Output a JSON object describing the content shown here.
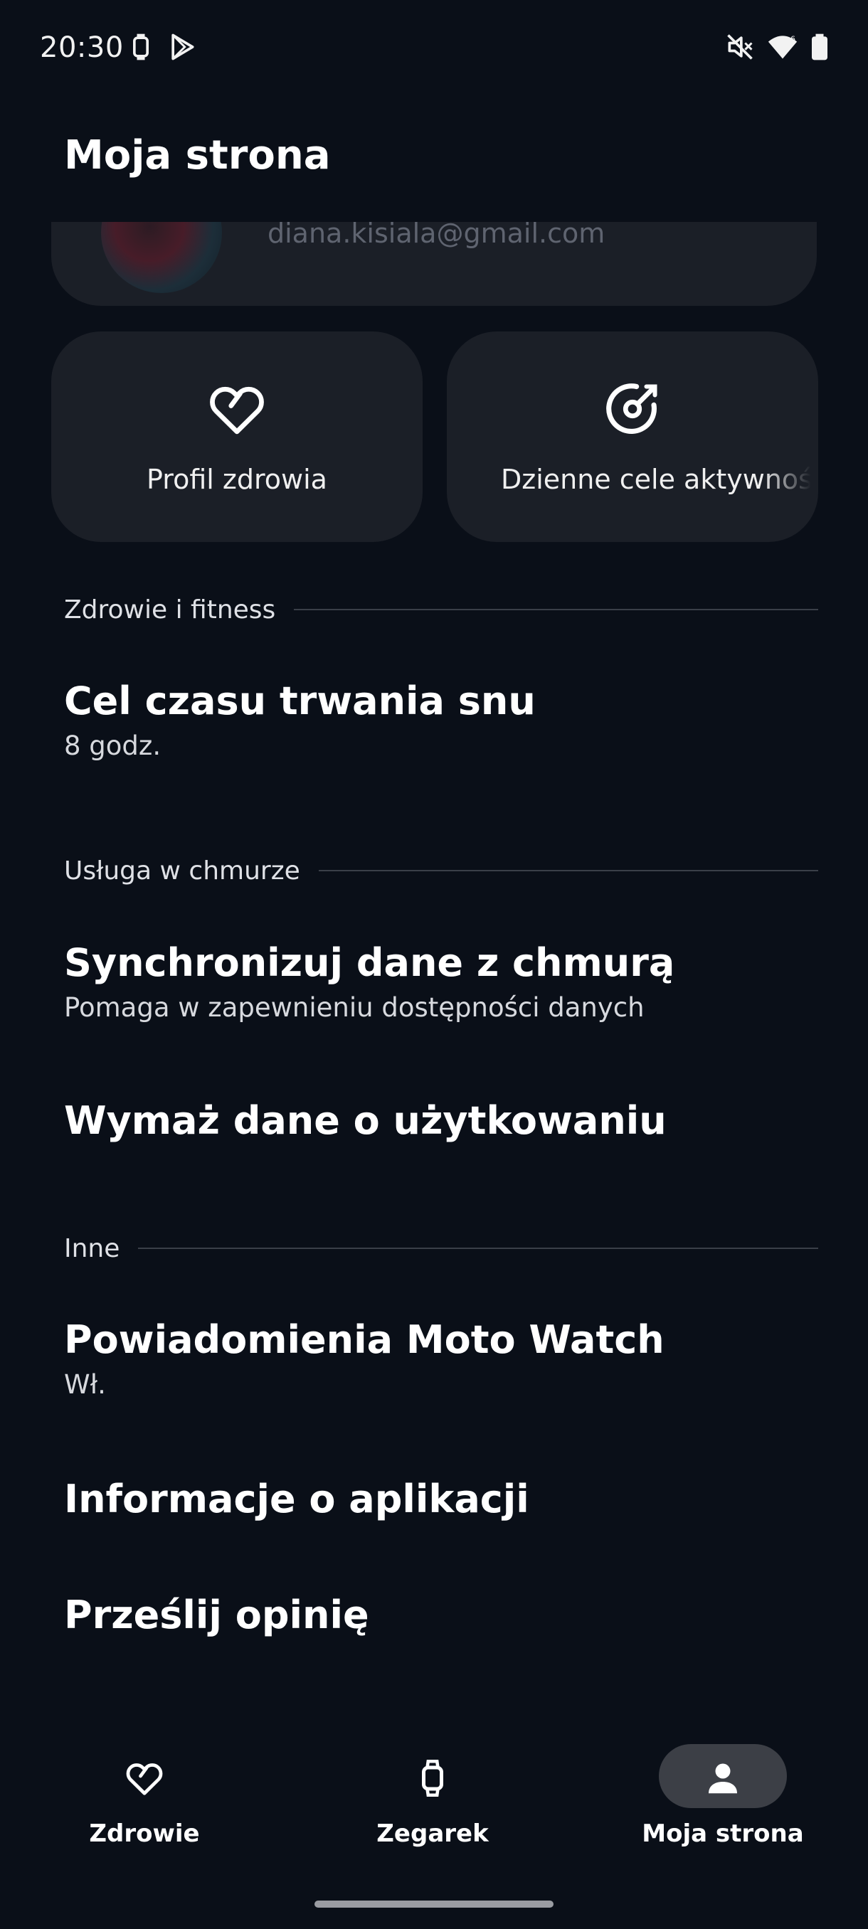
{
  "status_bar": {
    "time": "20:30",
    "icons_left": [
      "watch-icon",
      "play-store-icon"
    ],
    "icons_right": [
      "mute-icon",
      "wifi-icon",
      "battery-icon"
    ]
  },
  "page": {
    "title": "Moja strona"
  },
  "profile": {
    "email": "diana.kisiala@gmail.com"
  },
  "tiles": [
    {
      "label": "Profil zdrowia",
      "icon": "heart-icon"
    },
    {
      "label": "Dzienne cele aktywności",
      "icon": "target-icon"
    }
  ],
  "sections": {
    "health": {
      "header": "Zdrowie i fitness",
      "items": [
        {
          "title": "Cel czasu trwania snu",
          "subtitle": "8 godz."
        }
      ]
    },
    "cloud": {
      "header": "Usługa w chmurze",
      "items": [
        {
          "title": "Synchronizuj dane z chmurą",
          "subtitle": "Pomaga w zapewnieniu dostępności danych"
        },
        {
          "title": "Wymaż dane o użytkowaniu"
        }
      ]
    },
    "other": {
      "header": "Inne",
      "items": [
        {
          "title": "Powiadomienia Moto Watch",
          "subtitle": "Wł."
        },
        {
          "title": "Informacje o aplikacji"
        },
        {
          "title": "Prześlij opinię"
        }
      ]
    }
  },
  "bottom_nav": {
    "items": [
      {
        "label": "Zdrowie",
        "icon": "heart-icon",
        "active": false
      },
      {
        "label": "Zegarek",
        "icon": "watch-icon",
        "active": false
      },
      {
        "label": "Moja strona",
        "icon": "person-icon",
        "active": true
      }
    ]
  },
  "colors": {
    "background": "#0a0f18",
    "card": "#1b1f27",
    "active_pill": "#3c3f46",
    "text_primary": "#ffffff",
    "text_secondary": "#d7d9de"
  }
}
